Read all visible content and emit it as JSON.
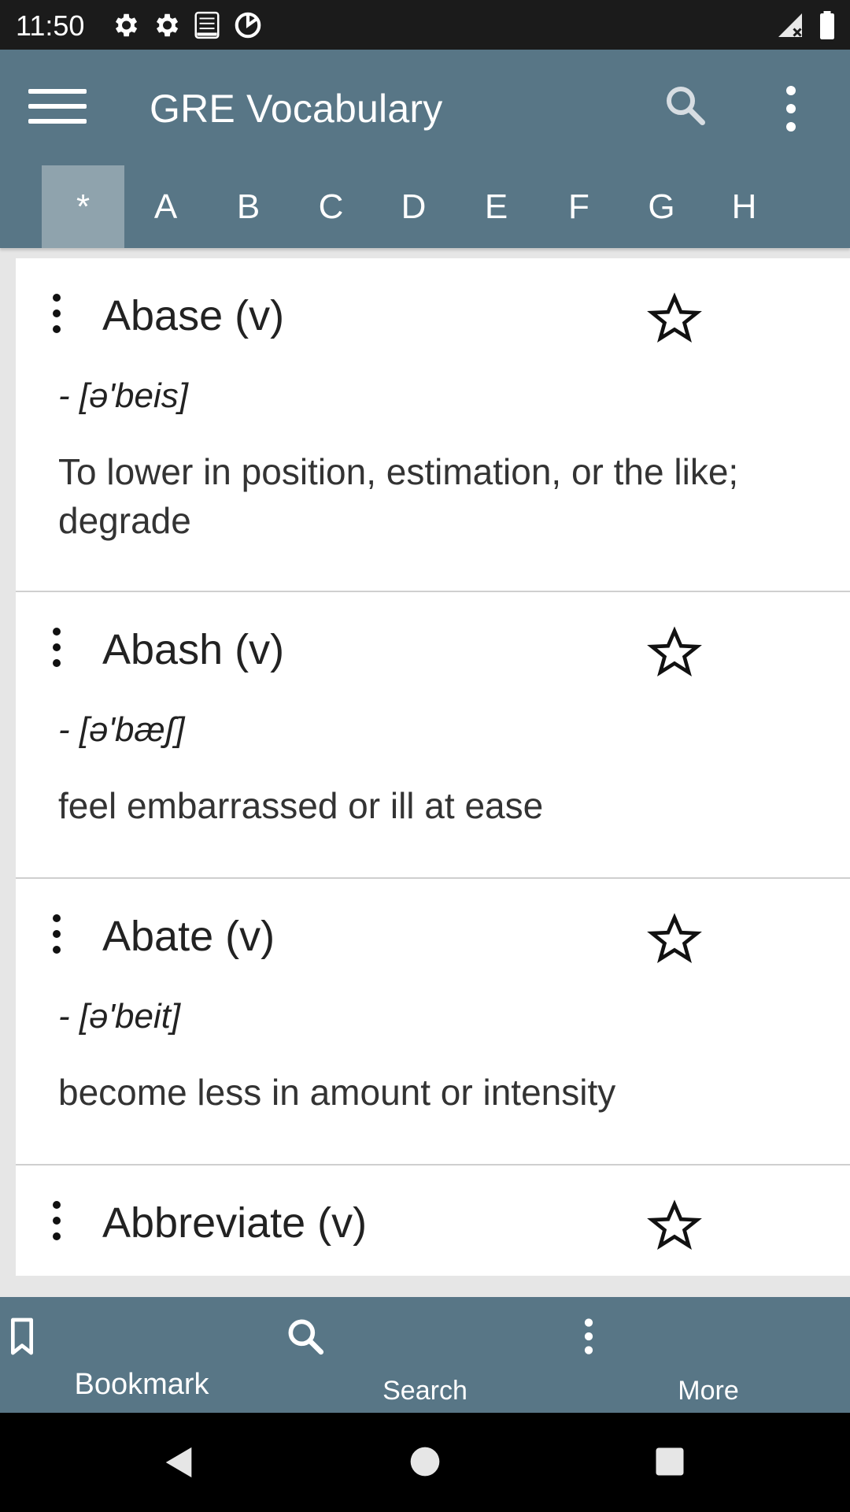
{
  "status": {
    "time": "11:50"
  },
  "app_bar": {
    "title": "GRE Vocabulary"
  },
  "letters": [
    "*",
    "A",
    "B",
    "C",
    "D",
    "E",
    "F",
    "G",
    "H"
  ],
  "active_letter_index": 0,
  "cards": [
    {
      "word": "Abase (v)",
      "phonetic": "- [ə'beis]",
      "definition": "To lower in position, estimation, or the like; degrade"
    },
    {
      "word": "Abash (v)",
      "phonetic": "- [ə'bæʃ]",
      "definition": "feel embarrassed or ill at ease"
    },
    {
      "word": "Abate (v)",
      "phonetic": "- [ə'beit]",
      "definition": "become less in amount or intensity"
    },
    {
      "word": "Abbreviate (v)",
      "phonetic": "",
      "definition": ""
    }
  ],
  "bottom_nav": {
    "bookmark_label": "Bookmark",
    "search_label": "Search",
    "more_label": "More"
  },
  "colors": {
    "primary": "#587686",
    "active_tab": "#8fa3ad"
  }
}
